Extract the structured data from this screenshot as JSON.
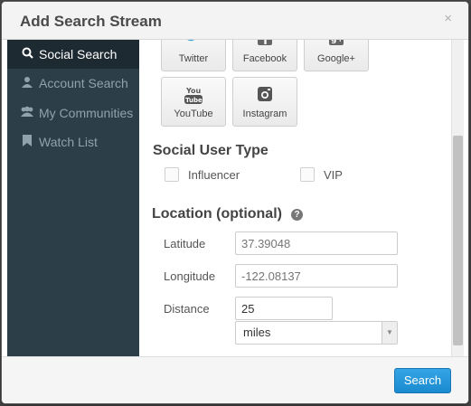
{
  "modal": {
    "title": "Add Search Stream",
    "close": "×"
  },
  "sidebar": {
    "items": [
      {
        "label": "Social Search",
        "icon": "search-icon",
        "glyph": "🔍",
        "active": true
      },
      {
        "label": "Account Search",
        "icon": "user-icon",
        "glyph": "👤"
      },
      {
        "label": "My Communities",
        "icon": "users-icon",
        "glyph": "👥"
      },
      {
        "label": "Watch List",
        "icon": "bookmark-icon",
        "glyph": "🔖"
      }
    ]
  },
  "networks": [
    {
      "label": "Twitter",
      "icon": "twitter-icon",
      "glyph": "🐦"
    },
    {
      "label": "Facebook",
      "icon": "facebook-icon",
      "glyph": "f"
    },
    {
      "label": "Google+",
      "icon": "google-plus-icon",
      "glyph": "g+"
    },
    {
      "label": "YouTube",
      "icon": "youtube-icon",
      "glyph": "You Tube"
    },
    {
      "label": "Instagram",
      "icon": "instagram-icon",
      "glyph": "◙"
    }
  ],
  "user_type": {
    "title": "Social User Type",
    "options": [
      {
        "label": "Influencer"
      },
      {
        "label": "VIP"
      }
    ]
  },
  "location": {
    "title": "Location (optional)",
    "help_glyph": "?",
    "latitude_label": "Latitude",
    "latitude_placeholder": "37.39048",
    "longitude_label": "Longitude",
    "longitude_placeholder": "-122.08137",
    "distance_label": "Distance",
    "distance_value": "25",
    "unit_selected": "miles",
    "unit_arrow": "▼"
  },
  "footer": {
    "search_label": "Search"
  },
  "colors": {
    "sidebar_bg": "#2c3e48",
    "sidebar_active": "#1e2a31",
    "accent": "#1b8bd0"
  }
}
